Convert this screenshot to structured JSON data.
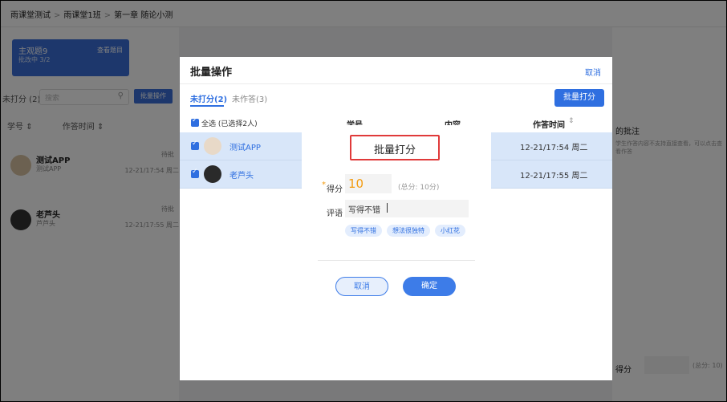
{
  "breadcrumb": [
    "雨课堂测试",
    "雨课堂1班",
    "第一章 随论小测"
  ],
  "topic_card": {
    "title": "主观题9",
    "subtitle": "批改中 3/2",
    "action": "查看题目"
  },
  "left_list": {
    "filter_label": "未打分 (2)",
    "search_placeholder": "搜索",
    "batch_button": "批量操作",
    "col_student_id": "学号",
    "col_time": "作答时间",
    "rows": [
      {
        "name": "测试APP",
        "student_id": "测试APP",
        "status": "待批",
        "time": "12-21/17:54 周二"
      },
      {
        "name": "老芦头",
        "student_id": "芦芦头",
        "status": "待批",
        "time": "12-21/17:55 周二"
      }
    ]
  },
  "right_panel": {
    "heading": "的批注",
    "desc": "学生作答内容不支持直接查看，可以点击查看作答",
    "grade_label": "得分",
    "grade_total": "(总分: 10)"
  },
  "batch_dialog": {
    "title": "批量操作",
    "cancel": "取消",
    "tab_ungraded": "未打分(2)",
    "tab_unanswered": "未作答(3)",
    "batch_grade_button": "批量打分",
    "select_all": "全选 (已选择2人)",
    "col_student_id": "学号",
    "col_content": "内容",
    "col_time": "作答时间",
    "rows": [
      {
        "name": "测试APP",
        "time": "12-21/17:54 周二"
      },
      {
        "name": "老芦头",
        "time": "12-21/17:55 周二"
      }
    ]
  },
  "score_dialog": {
    "title": "批量打分",
    "score_label": "得分",
    "required_mark": "*",
    "score_value": "10",
    "total": "(总分: 10分)",
    "comment_label": "评语",
    "comment_value": "写得不错",
    "chips": [
      "写得不错",
      "想法很独特",
      "小红花"
    ],
    "cancel": "取消",
    "confirm": "确定"
  }
}
